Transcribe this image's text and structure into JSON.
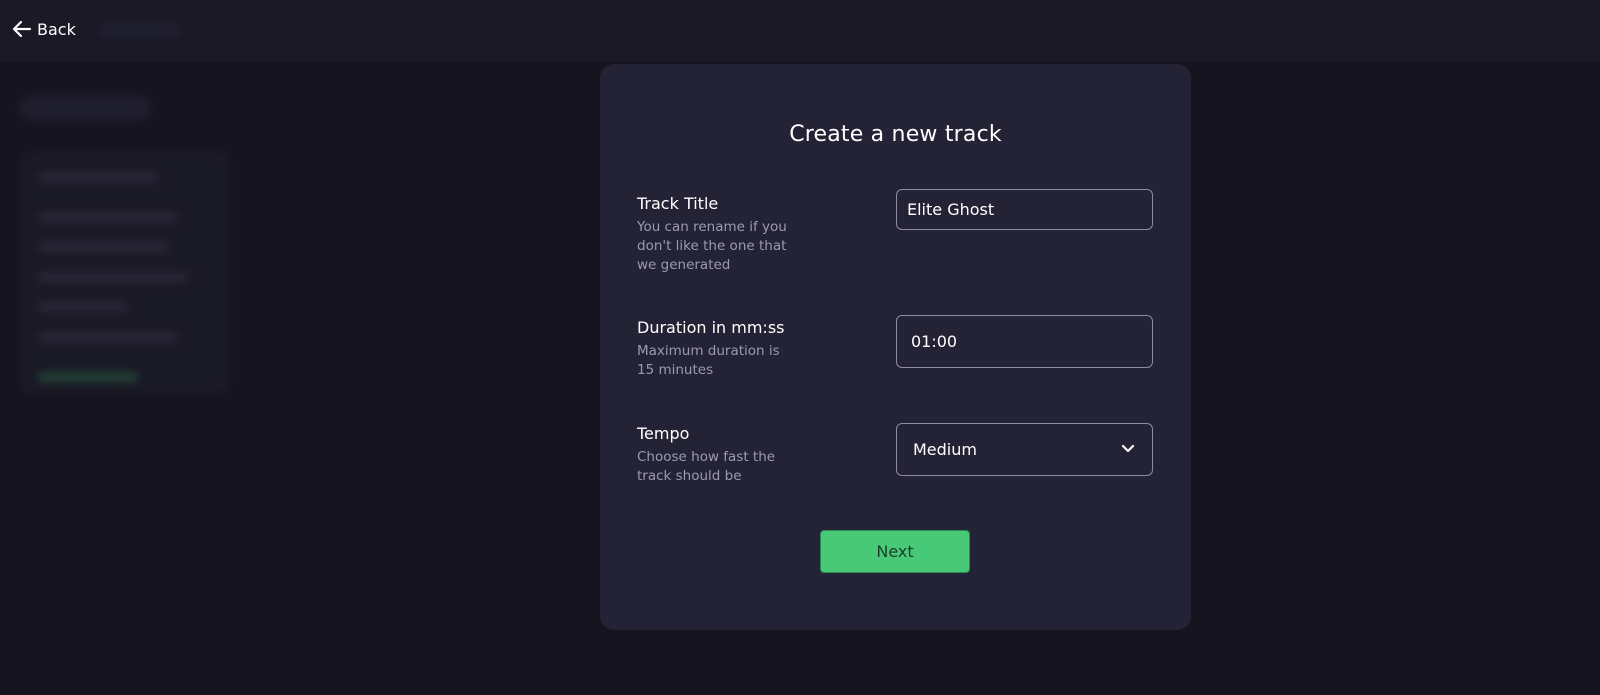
{
  "header": {
    "back_label": "Back",
    "back_icon": "arrow-left-icon"
  },
  "modal": {
    "title": "Create a new track",
    "fields": [
      {
        "label": "Track Title",
        "help": "You can rename if you don't like the one that we generated",
        "value": "Elite Ghost"
      },
      {
        "label": "Duration in mm:ss",
        "help": "Maximum duration is 15 minutes",
        "value": "01:00"
      },
      {
        "label": "Tempo",
        "help": "Choose how fast the track should be",
        "value": "Medium",
        "icon": "chevron-down-icon"
      }
    ],
    "next_label": "Next"
  },
  "colors": {
    "background": "#16151f",
    "modal": "#242335",
    "accent": "#48c978",
    "muted_text": "#9c9ab0"
  }
}
